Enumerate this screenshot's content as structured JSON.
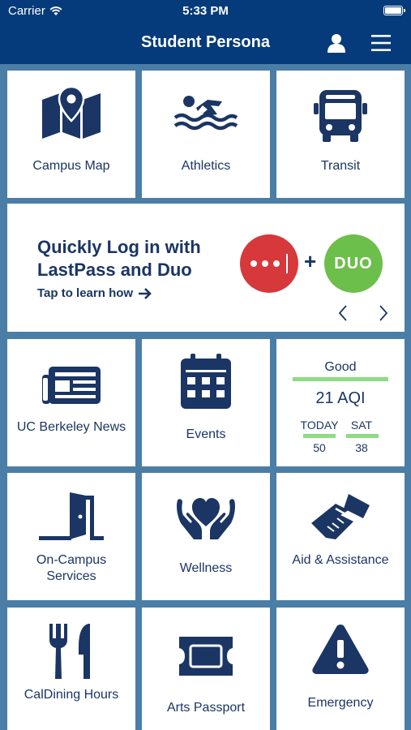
{
  "status_bar": {
    "carrier": "Carrier",
    "time": "5:33 PM"
  },
  "nav": {
    "title": "Student Persona",
    "profile_icon": "person-icon",
    "menu_icon": "hamburger-menu-icon"
  },
  "tiles_row1": [
    {
      "label": "Campus Map",
      "icon": "map-pin-icon"
    },
    {
      "label": "Athletics",
      "icon": "swimmer-icon"
    },
    {
      "label": "Transit",
      "icon": "bus-icon"
    }
  ],
  "banner": {
    "headline": "Quickly Log in with LastPass and Duo",
    "cta": "Tap to learn how",
    "plus": "+",
    "duo_logo": "DUO",
    "colors": {
      "lastpass": "#d7383b",
      "duo": "#6dbf4b"
    }
  },
  "tiles_row2": [
    {
      "label": "UC Berkeley News",
      "icon": "newspaper-icon"
    },
    {
      "label": "Events",
      "icon": "calendar-icon"
    }
  ],
  "aqi": {
    "quality": "Good",
    "value": "21 AQI",
    "forecast": [
      {
        "day": "TODAY",
        "value": "50"
      },
      {
        "day": "SAT",
        "value": "38"
      }
    ],
    "color": "#8edb85"
  },
  "tiles_row3": [
    {
      "label": "On-Campus Services",
      "icon": "door-icon"
    },
    {
      "label": "Wellness",
      "icon": "heart-hands-icon"
    },
    {
      "label": "Aid & Assistance",
      "icon": "handshake-icon"
    }
  ],
  "tiles_row4": [
    {
      "label": "CalDining Hours",
      "icon": "fork-knife-icon"
    },
    {
      "label": "Arts Passport",
      "icon": "ticket-icon"
    },
    {
      "label": "Emergency",
      "icon": "warning-icon"
    }
  ],
  "colors": {
    "primary": "#053b7a",
    "background": "#4a7ea6",
    "icon": "#1b3564"
  }
}
